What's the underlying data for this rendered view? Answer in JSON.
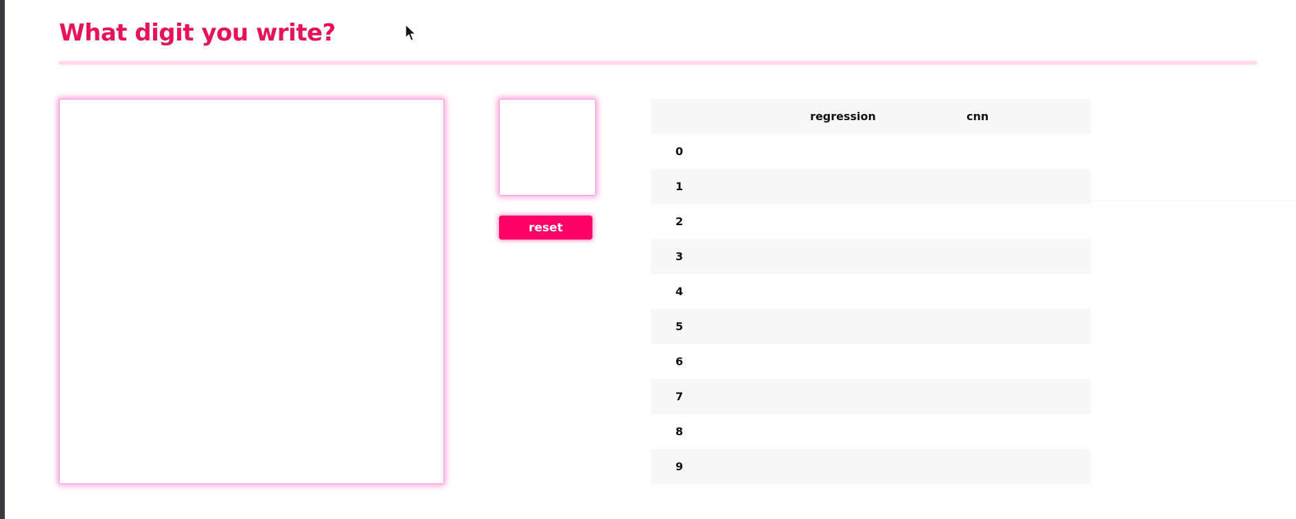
{
  "page": {
    "title": "What digit you write?"
  },
  "controls": {
    "reset_label": "reset"
  },
  "results": {
    "columns": [
      "",
      "regression",
      "cnn"
    ],
    "rows": [
      {
        "digit": "0",
        "regression": "",
        "cnn": ""
      },
      {
        "digit": "1",
        "regression": "",
        "cnn": ""
      },
      {
        "digit": "2",
        "regression": "",
        "cnn": ""
      },
      {
        "digit": "3",
        "regression": "",
        "cnn": ""
      },
      {
        "digit": "4",
        "regression": "",
        "cnn": ""
      },
      {
        "digit": "5",
        "regression": "",
        "cnn": ""
      },
      {
        "digit": "6",
        "regression": "",
        "cnn": ""
      },
      {
        "digit": "7",
        "regression": "",
        "cnn": ""
      },
      {
        "digit": "8",
        "regression": "",
        "cnn": ""
      },
      {
        "digit": "9",
        "regression": "",
        "cnn": ""
      }
    ]
  },
  "icons": {
    "cursor": "mouse-pointer-icon"
  },
  "colors": {
    "accent": "#e8125c",
    "button": "#ff0066",
    "glow": "#ff9bcb",
    "row_alt": "#f7f7f7"
  }
}
